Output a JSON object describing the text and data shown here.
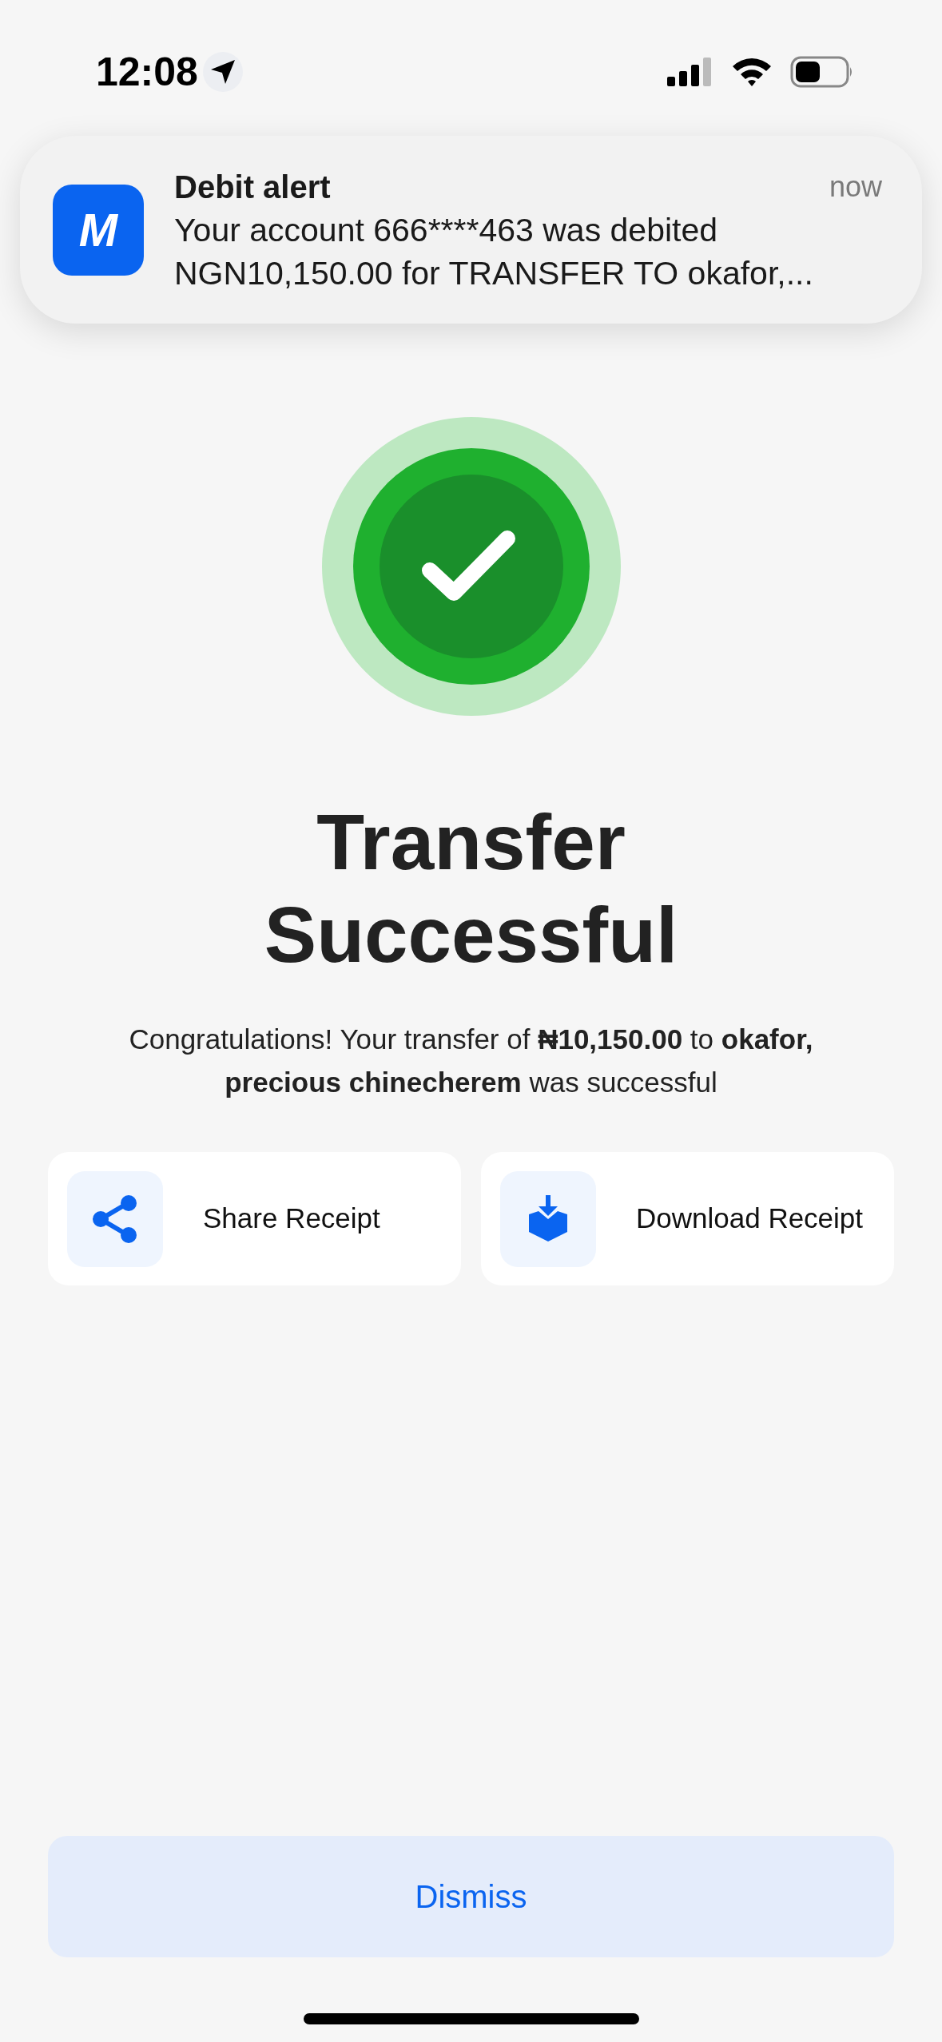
{
  "status_bar": {
    "time": "12:08"
  },
  "notification": {
    "app_letter": "M",
    "title": "Debit alert",
    "time": "now",
    "lines": [
      "Your account 666****463 was debited",
      "NGN10,150.00 for TRANSFER TO okafor,..."
    ]
  },
  "result": {
    "title_lines": [
      "Transfer",
      "Successful"
    ],
    "message": "Congratulations! Your transfer of **₦10,150.00** to **okafor, precious chinecherem** was successful"
  },
  "actions": [
    {
      "kind": "share",
      "label": "Share Receipt"
    },
    {
      "kind": "download",
      "label": "Download Receipt"
    }
  ],
  "dismiss_button": {
    "label": "Dismiss"
  }
}
